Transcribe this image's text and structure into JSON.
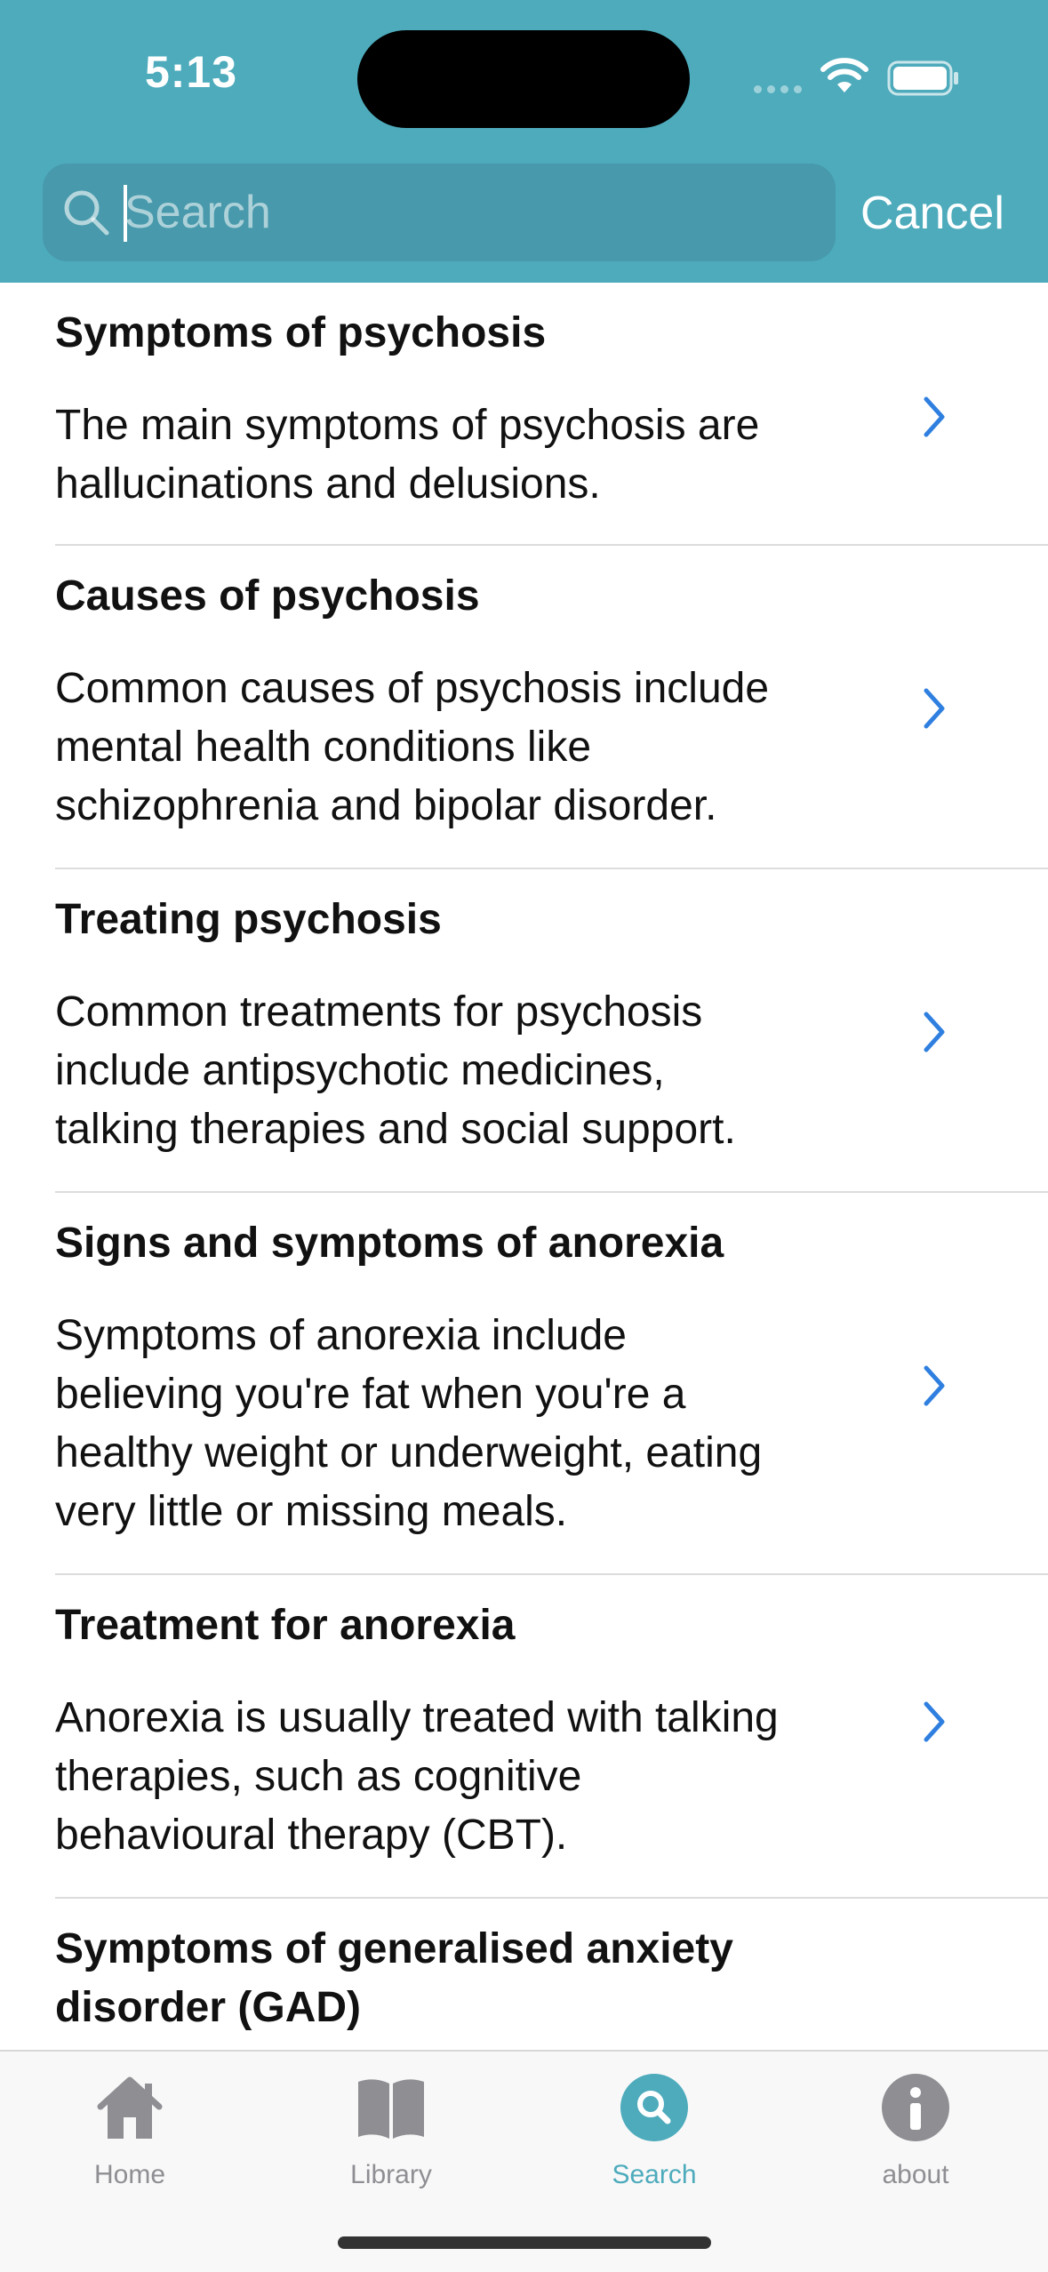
{
  "status": {
    "time": "5:13"
  },
  "search": {
    "placeholder": "Search",
    "value": "",
    "cancel_label": "Cancel"
  },
  "results": [
    {
      "title": "Symptoms of psychosis",
      "desc_lines": [
        "The main symptoms of psychosis are",
        "hallucinations and delusions."
      ]
    },
    {
      "title": "Causes of psychosis",
      "desc_lines": [
        "Common causes of psychosis include",
        "mental health conditions like",
        "schizophrenia and bipolar disorder."
      ]
    },
    {
      "title": "Treating psychosis",
      "desc_lines": [
        "Common treatments for psychosis",
        "include antipsychotic medicines,",
        "talking therapies and social support."
      ]
    },
    {
      "title": "Signs and symptoms of anorexia",
      "desc_lines": [
        "Symptoms of anorexia include",
        "believing you're fat when you're a",
        "healthy weight or underweight, eating",
        "very little or missing meals."
      ]
    },
    {
      "title": "Treatment for anorexia",
      "desc_lines": [
        "Anorexia is usually treated with talking",
        "therapies, such as cognitive",
        "behavioural therapy (CBT)."
      ]
    },
    {
      "title_lines": [
        "Symptoms of generalised anxiety",
        "disorder (GAD)"
      ]
    }
  ],
  "tabbar": {
    "tabs": [
      {
        "label": "Home",
        "icon": "home-icon"
      },
      {
        "label": "Library",
        "icon": "book-icon"
      },
      {
        "label": "Search",
        "icon": "search-icon",
        "active": true
      },
      {
        "label": "about",
        "icon": "info-icon"
      }
    ]
  },
  "colors": {
    "accent": "#4dabbc",
    "chevron": "#2f7fe0",
    "inactive": "#8e8e93"
  }
}
